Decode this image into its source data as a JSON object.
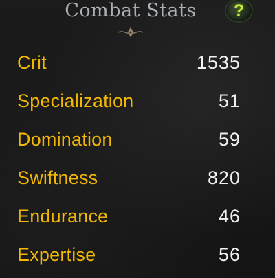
{
  "header": {
    "title": "Combat Stats",
    "help_label": "?",
    "help_icon": "question-icon",
    "ornament_icon": "ornament-divider-icon"
  },
  "stats": [
    {
      "label": "Crit",
      "value": "1535"
    },
    {
      "label": "Specialization",
      "value": "51"
    },
    {
      "label": "Domination",
      "value": "59"
    },
    {
      "label": "Swiftness",
      "value": "820"
    },
    {
      "label": "Endurance",
      "value": "46"
    },
    {
      "label": "Expertise",
      "value": "56"
    }
  ],
  "colors": {
    "label": "#f2b705",
    "value": "#f1f1f1",
    "title": "#aab0b6",
    "help_glyph": "#c9e83a",
    "background": "#161616"
  }
}
